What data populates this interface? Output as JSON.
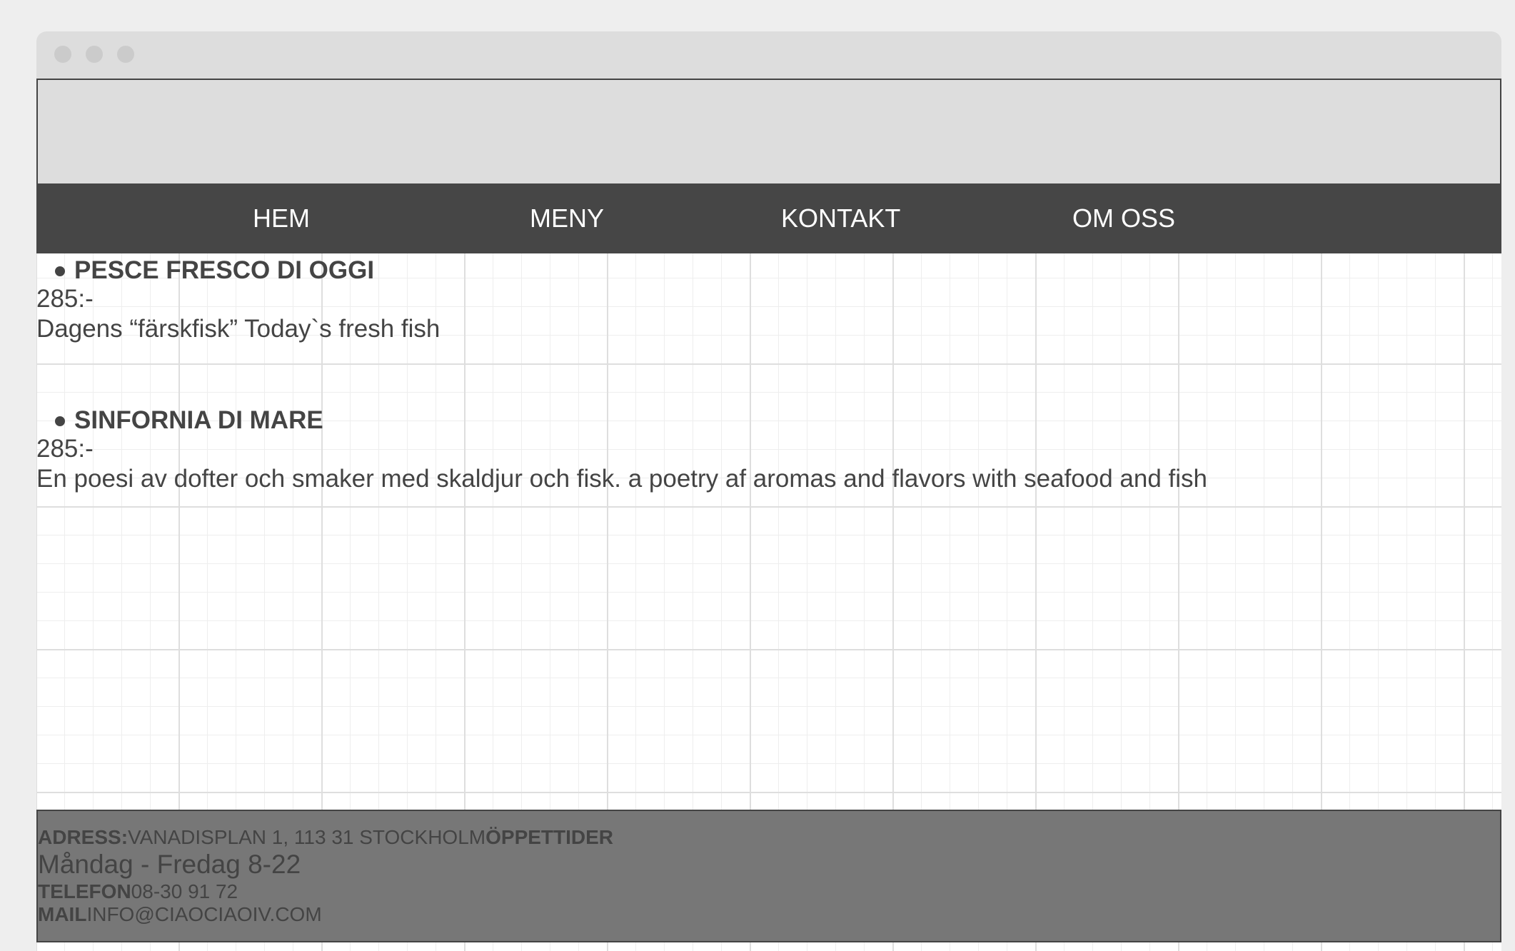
{
  "nav": {
    "items": [
      {
        "label": "HEM"
      },
      {
        "label": "MENY"
      },
      {
        "label": "KONTAKT"
      },
      {
        "label": "OM OSS"
      }
    ]
  },
  "menu": {
    "dishes": [
      {
        "name": "PESCE FRESCO DI OGGI",
        "price": "285:-",
        "description": "Dagens “färskfisk” Today`s fresh fish"
      },
      {
        "name": "SINFORNIA DI MARE",
        "price": "285:-",
        "description": "En poesi av dofter och smaker med skaldjur och fisk. a poetry af aromas and flavors with seafood and fish"
      }
    ]
  },
  "footer": {
    "address_label": "ADRESS:",
    "address_value": "VANADISPLAN 1, 113 31 STOCKHOLM",
    "hours_label": "ÖPPETTIDER",
    "hours_value": "Måndag - Fredag 8-22",
    "phone_label": "TELEFON",
    "phone_value": "08-30 91 72",
    "mail_label": "MAIL",
    "mail_value": "INFO@CIAOCIAOIV.COM"
  }
}
